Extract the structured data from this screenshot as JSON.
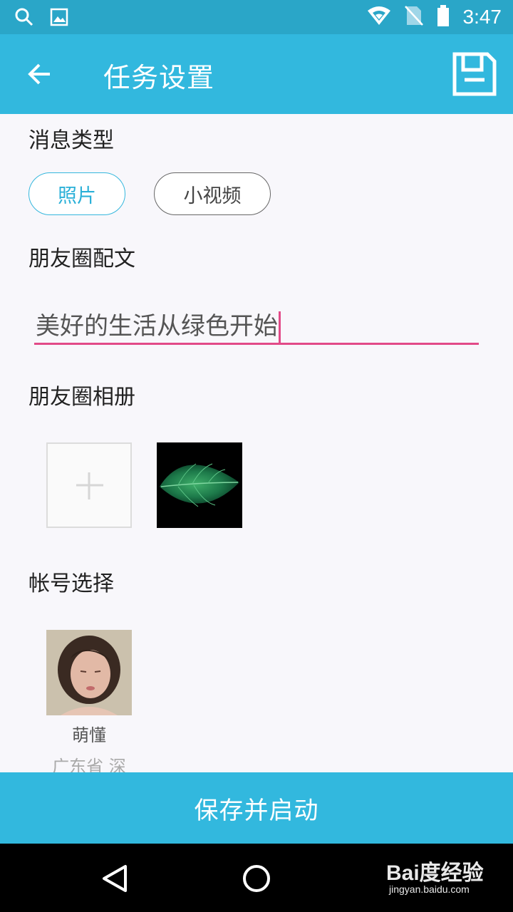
{
  "status_bar": {
    "time": "3:47"
  },
  "app_bar": {
    "title": "任务设置"
  },
  "sections": {
    "message_type": "消息类型",
    "caption": "朋友圈配文",
    "album": "朋友圈相册",
    "account": "帐号选择"
  },
  "message_types": [
    {
      "label": "照片",
      "selected": true
    },
    {
      "label": "小视频",
      "selected": false
    }
  ],
  "caption_input": {
    "value": "美好的生活从绿色开始"
  },
  "account": {
    "name": "萌懂",
    "region": "广东省 深"
  },
  "actions": {
    "save_and_start": "保存并启动"
  },
  "watermark": {
    "main": "Bai度经验",
    "sub": "jingyan.baidu.com"
  },
  "colors": {
    "accent": "#32b8de",
    "status_bar": "#2aa6c8",
    "input_underline": "#e24a88",
    "background": "#f8f7fb"
  }
}
